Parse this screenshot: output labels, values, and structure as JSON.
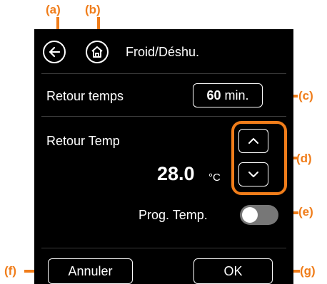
{
  "header": {
    "title": "Froid/Déshu.",
    "back_icon": "back-arrow-icon",
    "home_icon": "home-icon"
  },
  "rows": {
    "retour_temps": {
      "label": "Retour temps",
      "value": "60",
      "unit": "min."
    },
    "retour_temp": {
      "label": "Retour Temp",
      "value": "28.0",
      "unit": "°C",
      "up_icon": "chevron-up-icon",
      "down_icon": "chevron-down-icon"
    },
    "prog_temp": {
      "label": "Prog. Temp.",
      "toggle_on": false
    }
  },
  "footer": {
    "cancel_label": "Annuler",
    "ok_label": "OK"
  },
  "callouts": {
    "a": "(a)",
    "b": "(b)",
    "c": "(c)",
    "d": "(d)",
    "e": "(e)",
    "f": "(f)",
    "g": "(g)"
  },
  "colors": {
    "accent": "#f07d1a",
    "screen_bg": "#000000",
    "toggle_off": "#777777"
  }
}
